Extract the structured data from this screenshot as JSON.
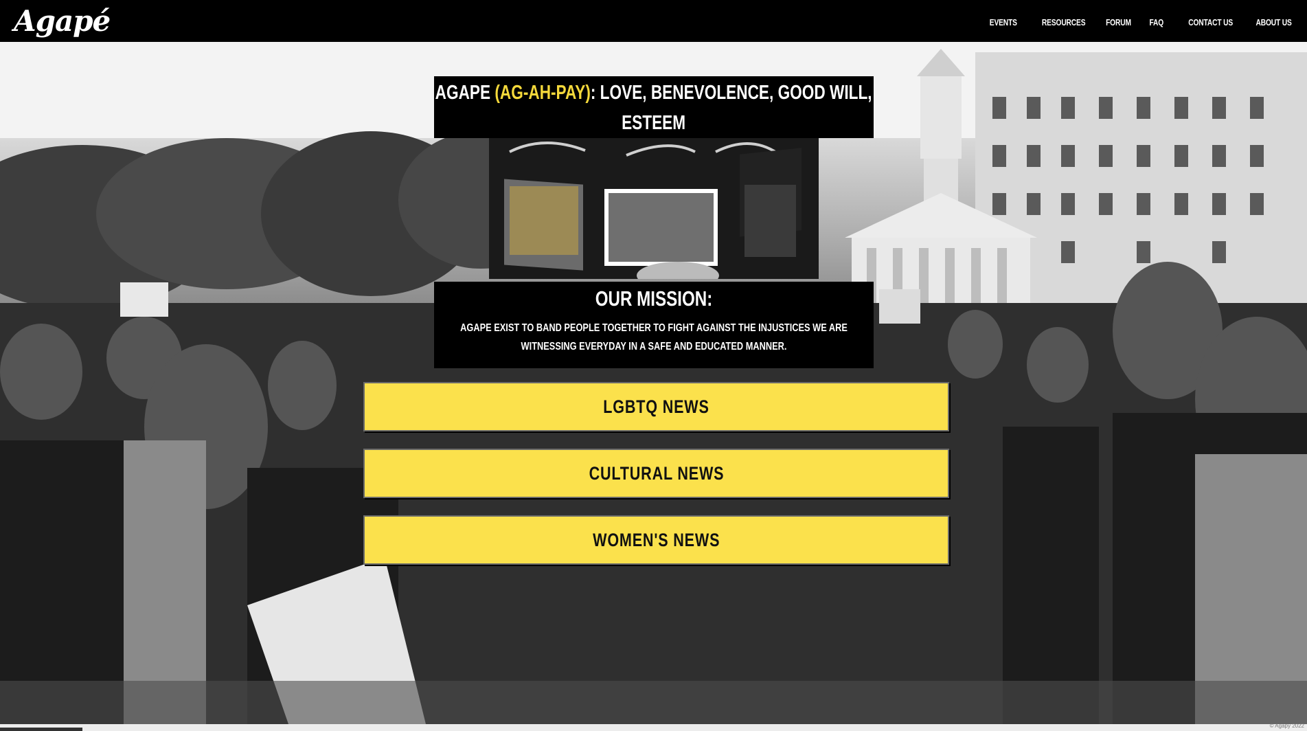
{
  "brand": {
    "logo_text": "Agapé"
  },
  "nav": {
    "links": [
      "EVENTS",
      "RESOURCES",
      "FORUM",
      "FAQ",
      "CONTACT US",
      "ABOUT US"
    ]
  },
  "headline": {
    "word": "AGAPE ",
    "pronunciation": "(AG-AH-PAY)",
    "definition": ": LOVE, BENEVOLENCE, GOOD WILL, ESTEEM"
  },
  "mission": {
    "title": "OUR MISSION:",
    "text": "AGAPE EXIST TO BAND PEOPLE TOGETHER TO FIGHT AGAINST THE INJUSTICES WE ARE WITNESSING EVERYDAY IN A SAFE AND EDUCATED MANNER."
  },
  "news_buttons": {
    "lgbtq": "LGBTQ NEWS",
    "cultural": "CULTURAL NEWS",
    "womens": "WOMEN'S NEWS"
  },
  "footer": {
    "copyright": "© Agapy 2022"
  },
  "colors": {
    "accent_yellow": "#fbe14c",
    "pronunciation_yellow": "#f5d93b",
    "nav_bg": "#000000"
  }
}
